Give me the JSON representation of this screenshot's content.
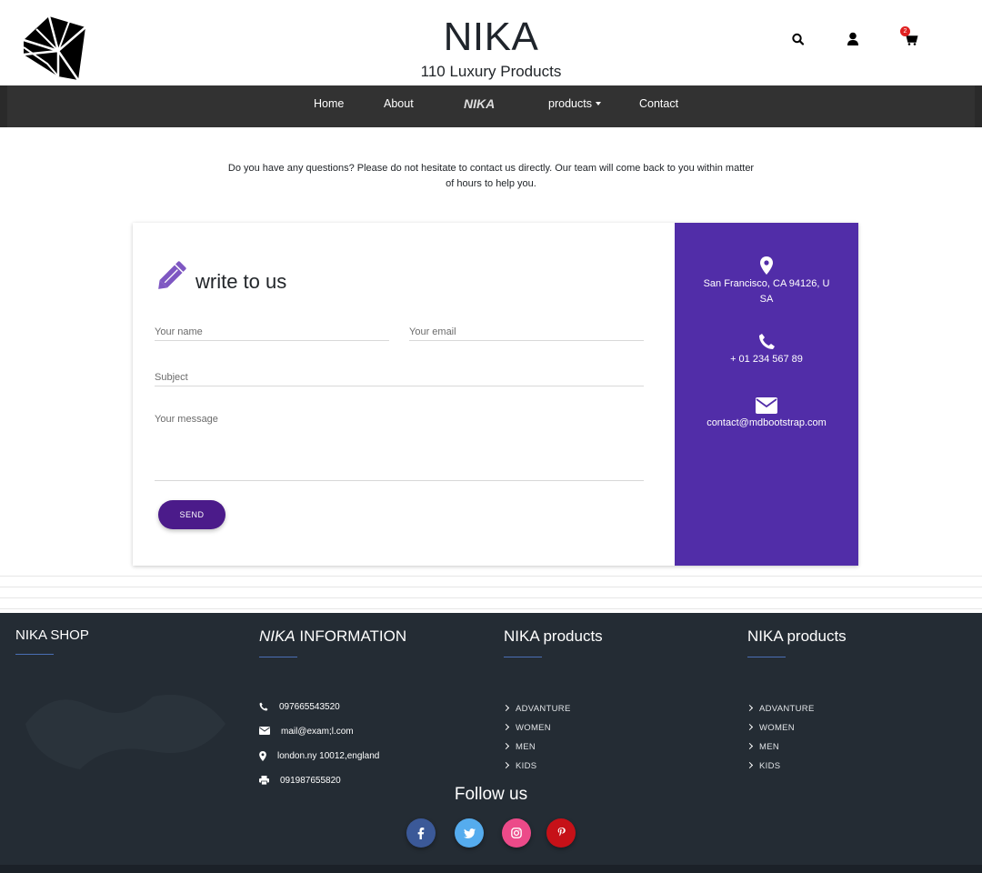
{
  "header": {
    "brand": "NIKA",
    "subtitle": "110 Luxury Products",
    "cart_count": "2",
    "icons": [
      "search-icon",
      "user-icon",
      "cart-icon"
    ]
  },
  "nav": {
    "items": [
      "Home",
      "About",
      "NIKA",
      "products",
      "Contact"
    ]
  },
  "intro": {
    "text": "Do you have any questions? Please do not hesitate to contact us directly. Our team will come back to you within matter of hours to help you."
  },
  "contact_form": {
    "title": "write to us",
    "name_placeholder": "Your name",
    "email_placeholder": "Your email",
    "subject_placeholder": "Subject",
    "message_placeholder": "Your message",
    "send_label": "SEND"
  },
  "contact_info": {
    "address": "San Francisco, CA 94126, USA",
    "phone": "+ 01 234 567 89",
    "email": "contact@mdbootstrap.com",
    "accent_color": "#512da8"
  },
  "footer": {
    "shop_title": "NIKA SHOP",
    "info_title_brand": "NIKA",
    "info_title_rest": " INFORMATION",
    "info": {
      "phone": "097665543520",
      "mail": "mail@exam;l.com",
      "address": "london.ny 10012,england",
      "fax": "091987655820"
    },
    "products_title_1": "NIKA products",
    "products_title_2": "NIKA products",
    "products_1": [
      "ADVANTURE",
      "WOMEN",
      "MEN",
      "KIDS"
    ],
    "products_2": [
      "ADVANTURE",
      "WOMEN",
      "MEN",
      "KIDS"
    ],
    "follow_label": "Follow us",
    "social": [
      {
        "icon": "facebook-icon",
        "color": "#3b5998"
      },
      {
        "icon": "twitter-icon",
        "color": "#55acee"
      },
      {
        "icon": "instagram-icon",
        "color": "#ec4a89"
      },
      {
        "icon": "pinterest-icon",
        "color": "#c61118"
      }
    ]
  }
}
